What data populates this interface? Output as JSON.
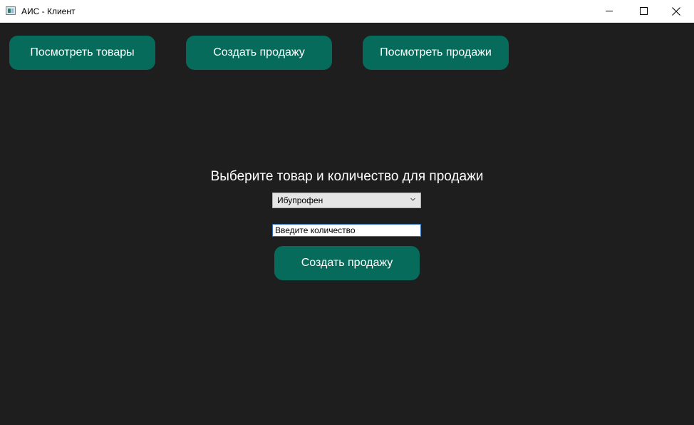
{
  "window": {
    "title": "АИС - Клиент"
  },
  "nav": {
    "view_products": "Посмотреть товары",
    "create_sale": "Создать продажу",
    "view_sales": "Посмотреть продажи"
  },
  "form": {
    "prompt": "Выберите товар и количество для продажи",
    "product_selected": "Ибупрофен",
    "quantity_value": "Введите количество",
    "submit_label": "Создать продажу"
  },
  "colors": {
    "background": "#1e1e1e",
    "button": "#076b5b",
    "button_text": "#ffffff"
  },
  "icons": [
    "app-icon",
    "minimize-icon",
    "maximize-icon",
    "close-icon",
    "chevron-down-icon"
  ]
}
